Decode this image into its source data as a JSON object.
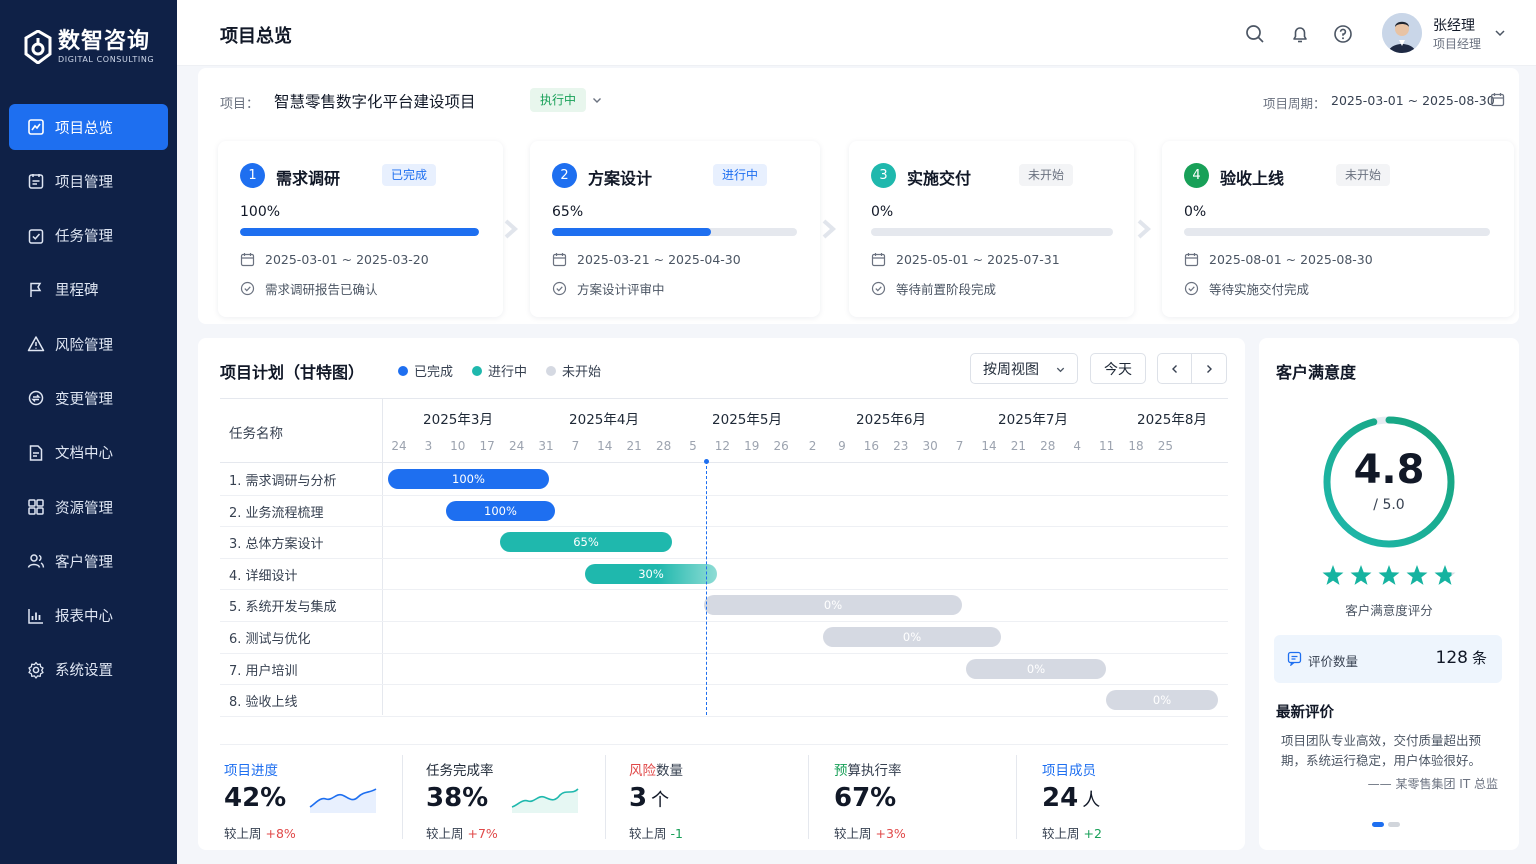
{
  "brand": {
    "name": "数智咨询",
    "subtitle": "DIGITAL CONSULTING"
  },
  "sidebar": {
    "items": [
      {
        "label": "项目总览",
        "icon": "dashboard-icon",
        "active": true
      },
      {
        "label": "项目管理",
        "icon": "project-icon"
      },
      {
        "label": "任务管理",
        "icon": "task-icon"
      },
      {
        "label": "里程碑",
        "icon": "flag-icon"
      },
      {
        "label": "风险管理",
        "icon": "warning-icon"
      },
      {
        "label": "变更管理",
        "icon": "change-icon"
      },
      {
        "label": "文档中心",
        "icon": "document-icon"
      },
      {
        "label": "资源管理",
        "icon": "resource-icon"
      },
      {
        "label": "客户管理",
        "icon": "customer-icon"
      },
      {
        "label": "报表中心",
        "icon": "report-icon"
      },
      {
        "label": "系统设置",
        "icon": "settings-icon"
      }
    ]
  },
  "header": {
    "title": "项目总览",
    "user": {
      "name": "张经理",
      "role": "项目经理"
    }
  },
  "project": {
    "label": "项目：",
    "name": "智慧零售数字化平台建设项目",
    "status": "执行中",
    "period_label": "项目周期：",
    "period": "2025-03-01 ~ 2025-08-30"
  },
  "phases": [
    {
      "num": "1",
      "title": "需求调研",
      "tag": "已完成",
      "percent": "100%",
      "progress": 1.0,
      "dates": "2025-03-01 ~ 2025-03-20",
      "note": "需求调研报告已确认"
    },
    {
      "num": "2",
      "title": "方案设计",
      "tag": "进行中",
      "percent": "65%",
      "progress": 0.65,
      "dates": "2025-03-21 ~ 2025-04-30",
      "note": "方案设计评审中"
    },
    {
      "num": "3",
      "title": "实施交付",
      "tag": "未开始",
      "percent": "0%",
      "progress": 0,
      "dates": "2025-05-01 ~ 2025-07-31",
      "note": "等待前置阶段完成"
    },
    {
      "num": "4",
      "title": "验收上线",
      "tag": "未开始",
      "percent": "0%",
      "progress": 0,
      "dates": "2025-08-01 ~ 2025-08-30",
      "note": "等待实施交付完成"
    }
  ],
  "gantt": {
    "title": "项目计划（甘特图）",
    "legend": [
      "已完成",
      "进行中",
      "未开始"
    ],
    "view_select": "按周视图",
    "today_button": "今天",
    "task_header": "任务名称",
    "months": [
      "2025年3月",
      "2025年4月",
      "2025年5月",
      "2025年6月",
      "2025年7月",
      "2025年8月"
    ],
    "days": [
      "24",
      "3",
      "10",
      "17",
      "24",
      "31",
      "7",
      "14",
      "21",
      "28",
      "5",
      "12",
      "19",
      "26",
      "2",
      "9",
      "16",
      "23",
      "30",
      "7",
      "14",
      "21",
      "28",
      "4",
      "11",
      "18",
      "25"
    ],
    "tasks": [
      {
        "name": "1. 需求调研与分析",
        "label": "100%",
        "progress": 1.0,
        "status": "done"
      },
      {
        "name": "2. 业务流程梳理",
        "label": "100%",
        "progress": 1.0,
        "status": "done"
      },
      {
        "name": "3. 总体方案设计",
        "label": "65%",
        "progress": 0.65,
        "status": "doing"
      },
      {
        "name": "4. 详细设计",
        "label": "30%",
        "progress": 0.3,
        "status": "doing"
      },
      {
        "name": "5. 系统开发与集成",
        "label": "0%",
        "progress": 0,
        "status": "todo"
      },
      {
        "name": "6. 测试与优化",
        "label": "0%",
        "progress": 0,
        "status": "todo"
      },
      {
        "name": "7. 用户培训",
        "label": "0%",
        "progress": 0,
        "status": "todo"
      },
      {
        "name": "8. 验收上线",
        "label": "0%",
        "progress": 0,
        "status": "todo"
      }
    ]
  },
  "stats": [
    {
      "label": "项目进度",
      "value": "42%",
      "unit": "",
      "cmp_label": "较上周",
      "delta": "+8%",
      "label_color": "#1e6ff0",
      "delta_color": "#e04848"
    },
    {
      "label": "任务完成率",
      "value": "38%",
      "unit": "",
      "cmp_label": "较上周",
      "delta": "+7%",
      "label_color": "#374151",
      "delta_color": "#e04848"
    },
    {
      "label_prefix": "风险",
      "label_suffix": "数量",
      "value": "3",
      "unit": "个",
      "cmp_label": "较上周",
      "delta": "-1",
      "label_color": "#e04848",
      "delta_color": "#18a058"
    },
    {
      "label_prefix": "预",
      "label_suffix": "算执行率",
      "value": "67%",
      "unit": "",
      "cmp_label": "较上周",
      "delta": "+3%",
      "label_color": "#18a058",
      "delta_color": "#e04848"
    },
    {
      "label": "项目成员",
      "value": "24",
      "unit": "人",
      "cmp_label": "较上周",
      "delta": "+2",
      "label_color": "#1e6ff0",
      "delta_color": "#18a058"
    }
  ],
  "satisfaction": {
    "title": "客户满意度",
    "score": "4.8",
    "max": "/ 5.0",
    "rating": 4.8,
    "caption": "客户满意度评分",
    "count_label": "评价数量",
    "count_value": "128",
    "count_unit": "条",
    "review_title": "最新评价",
    "review_text": "项目团队专业高效，交付质量超出预期，系统运行稳定，用户体验很好。",
    "review_author": "—— 某零售集团 IT 总监"
  },
  "colors": {
    "primary": "#1e6ff0",
    "teal": "#1fb8ad",
    "green": "#18a058",
    "gray_bar": "#d5d9e2",
    "sidebar_bg": "#0f2147"
  }
}
